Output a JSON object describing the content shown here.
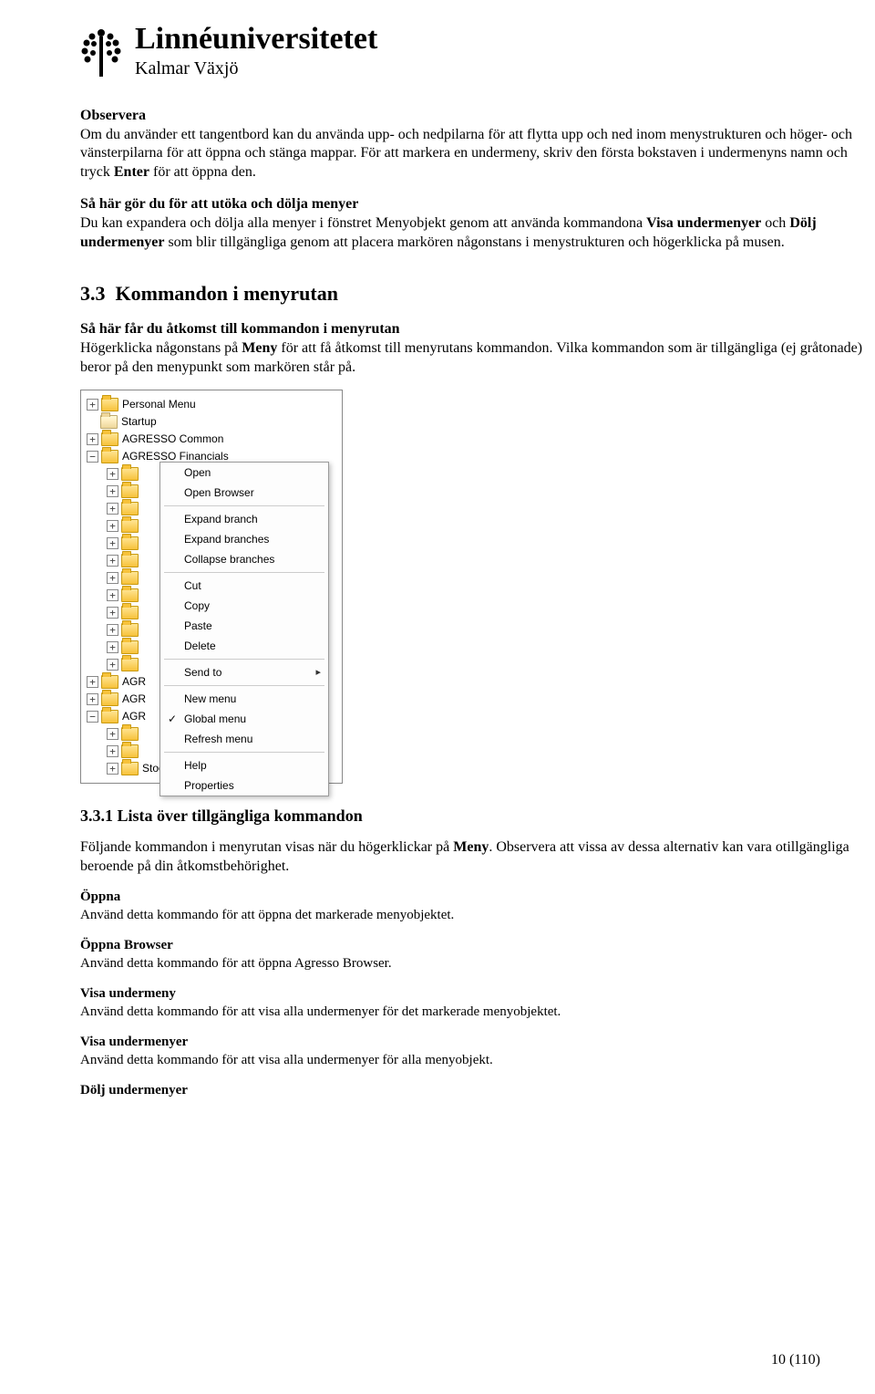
{
  "header": {
    "title": "Linnéuniversitetet",
    "subtitle": "Kalmar Växjö"
  },
  "observera": {
    "h": "Observera",
    "p1a": "Om du använder ett tangentbord kan du använda upp- och nedpilarna för att flytta upp och ned inom menystrukturen och höger- och vänsterpilarna för att öppna och stänga mappar. För att markera en undermeny, skriv den första bokstaven i undermenyns namn och tryck ",
    "enter": "Enter",
    "p1b": " för att öppna den."
  },
  "utoka": {
    "h": "Så här gör du för att utöka och dölja menyer",
    "p_a": "Du kan expandera och dölja alla menyer i fönstret Menyobjekt genom att använda kommandona ",
    "b1": "Visa undermenyer",
    "p_b": " och ",
    "b2": "Dölj undermenyer",
    "p_c": " som blir tillgängliga genom att placera markören någonstans i menystrukturen och högerklicka på musen."
  },
  "sec33": {
    "num": "3.3",
    "title": "Kommandon i menyrutan",
    "ah": "Så här får du åtkomst till kommandon i menyrutan",
    "ap_a": "Högerklicka någonstans på ",
    "ap_b1": "Meny",
    "ap_c": " för att få åtkomst till menyrutans kommandon. Vilka kommandon som är tillgängliga (ej gråtonade) beror på den menypunkt som markören står på."
  },
  "tree": {
    "items": [
      {
        "lvl": 0,
        "exp": "+",
        "icon": "folder",
        "label": "Personal Menu"
      },
      {
        "lvl": 0,
        "exp": "",
        "icon": "closed",
        "label": "Startup"
      },
      {
        "lvl": 0,
        "exp": "+",
        "icon": "folder",
        "label": "AGRESSO Common"
      },
      {
        "lvl": 0,
        "exp": "−",
        "icon": "folder",
        "label": "AGRESSO Financials"
      },
      {
        "lvl": 1,
        "exp": "+",
        "icon": "folder",
        "label": ""
      },
      {
        "lvl": 1,
        "exp": "+",
        "icon": "folder",
        "label": ""
      },
      {
        "lvl": 1,
        "exp": "+",
        "icon": "folder",
        "label": ""
      },
      {
        "lvl": 1,
        "exp": "+",
        "icon": "folder",
        "label": ""
      },
      {
        "lvl": 1,
        "exp": "+",
        "icon": "folder",
        "label": ""
      },
      {
        "lvl": 1,
        "exp": "+",
        "icon": "folder",
        "label": ""
      },
      {
        "lvl": 1,
        "exp": "+",
        "icon": "folder",
        "label": ""
      },
      {
        "lvl": 1,
        "exp": "+",
        "icon": "folder",
        "label": ""
      },
      {
        "lvl": 1,
        "exp": "+",
        "icon": "folder",
        "label": ""
      },
      {
        "lvl": 1,
        "exp": "+",
        "icon": "folder",
        "label": ""
      },
      {
        "lvl": 1,
        "exp": "+",
        "icon": "folder",
        "label": ""
      },
      {
        "lvl": 1,
        "exp": "+",
        "icon": "folder",
        "label": ""
      },
      {
        "lvl": 0,
        "exp": "+",
        "icon": "folder",
        "label": "AGR"
      },
      {
        "lvl": 0,
        "exp": "+",
        "icon": "folder",
        "label": "AGR"
      },
      {
        "lvl": 0,
        "exp": "−",
        "icon": "folder",
        "label": "AGR"
      },
      {
        "lvl": 1,
        "exp": "+",
        "icon": "folder",
        "label": ""
      },
      {
        "lvl": 1,
        "exp": "+",
        "icon": "folder",
        "label": ""
      },
      {
        "lvl": 1,
        "exp": "+",
        "icon": "folder",
        "label": "Stock rental"
      }
    ]
  },
  "ctx": [
    {
      "t": "item",
      "label": "Open"
    },
    {
      "t": "item",
      "label": "Open Browser"
    },
    {
      "t": "sep"
    },
    {
      "t": "item",
      "label": "Expand branch"
    },
    {
      "t": "item",
      "label": "Expand branches"
    },
    {
      "t": "item",
      "label": "Collapse branches"
    },
    {
      "t": "sep"
    },
    {
      "t": "item",
      "label": "Cut"
    },
    {
      "t": "item",
      "label": "Copy"
    },
    {
      "t": "item",
      "label": "Paste"
    },
    {
      "t": "item",
      "label": "Delete"
    },
    {
      "t": "sep"
    },
    {
      "t": "item",
      "label": "Send to",
      "arrow": true
    },
    {
      "t": "sep"
    },
    {
      "t": "item",
      "label": "New menu"
    },
    {
      "t": "item",
      "label": "Global menu",
      "check": true
    },
    {
      "t": "item",
      "label": "Refresh menu"
    },
    {
      "t": "sep"
    },
    {
      "t": "item",
      "label": "Help"
    },
    {
      "t": "item",
      "label": "Properties"
    }
  ],
  "sec331": {
    "num": "3.3.1",
    "title": "Lista över tillgängliga kommandon",
    "p_a": "Följande kommandon i menyrutan visas när du högerklickar på ",
    "p_b1": "Meny",
    "p_c": ". Observera att vissa av dessa alternativ kan vara otillgängliga beroende på din åtkomstbehörighet."
  },
  "cmds": [
    {
      "h": "Öppna",
      "p": "Använd detta kommando för att öppna det markerade menyobjektet."
    },
    {
      "h": "Öppna Browser",
      "p": "Använd detta kommando för att öppna Agresso Browser."
    },
    {
      "h": "Visa undermeny",
      "p": "Använd detta kommando för att visa alla undermenyer för det markerade menyobjektet."
    },
    {
      "h": "Visa undermenyer",
      "p": "Använd detta kommando för att visa alla undermenyer för alla menyobjekt."
    },
    {
      "h": "Dölj undermenyer",
      "p": ""
    }
  ],
  "footer": {
    "page": "10 (110)"
  }
}
